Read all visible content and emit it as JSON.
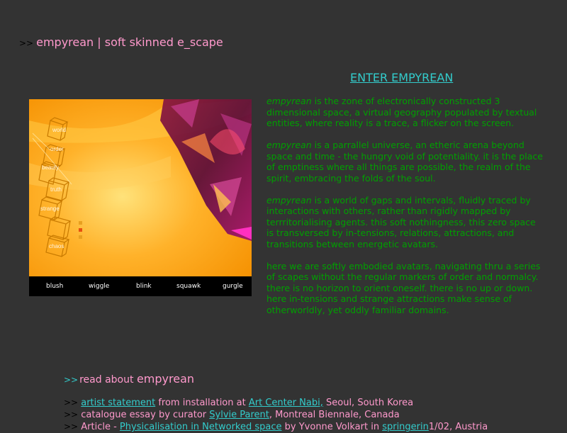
{
  "header": {
    "arrows": ">>",
    "title": "empyrean | soft skinned e_scape"
  },
  "enter_link": "ENTER EMPYREAN",
  "scene": {
    "labels": [
      "world",
      "order",
      "beauty",
      "truth",
      "strange",
      "",
      "chaos"
    ],
    "menu": [
      "blush",
      "wiggle",
      "blink",
      "squawk",
      "gurgle"
    ]
  },
  "description": {
    "p1": {
      "em": "empyrean",
      "text": " is the zone of electronically constructed 3 dimensional space, a virtual geography populated by textual entities, where reality is a trace, a flicker on the screen."
    },
    "p2": {
      "em": "empyrean",
      "text": " is a parrallel universe, an etheric arena beyond space and time - the hungry void of potentiality. it is the place of emptiness where all things are possible, the realm of the spirit, embracing the folds of the soul."
    },
    "p3": {
      "em": "empyrean",
      "text": " is a world of gaps and intervals, fluidly traced by interactions with others, rather than rigidly mapped by terrritorialising agents. this soft nothingness, this zero space is transversed by in-tensions, relations, attractions, and transitions between energetic avatars."
    },
    "p4": {
      "text": "here we are softly embodied avatars, navigating thru a series of scapes without the regular markers of order and normalcy. there is no horizon to orient oneself. there is no up or down. here in-tensions and strange attractions make sense of otherworldly, yet oddly familiar domains."
    }
  },
  "read_about": {
    "arrows": ">>",
    "prefix": "read about ",
    "name": "empyrean"
  },
  "links": [
    {
      "arrows": ">>",
      "link": "artist statement",
      "mid": " from installation at ",
      "link2": "Art Center Nabi,",
      "suffix": " Seoul, South Korea"
    },
    {
      "arrows": ">>",
      "prefix": "catalogue essay by curator ",
      "link": "Sylvie Parent",
      "suffix": ", Montreal Biennale, Canada"
    },
    {
      "arrows": ">>",
      "prefix": "Article - ",
      "link": "Physicalisation in Networked space",
      "mid": " by Yvonne Volkart in ",
      "link2": "springerin",
      "suffix": "1/02, Austria"
    }
  ],
  "colors": {
    "background": "#333333",
    "pink": "#ff99cc",
    "cyan": "#33cccc",
    "green": "#00a000"
  }
}
